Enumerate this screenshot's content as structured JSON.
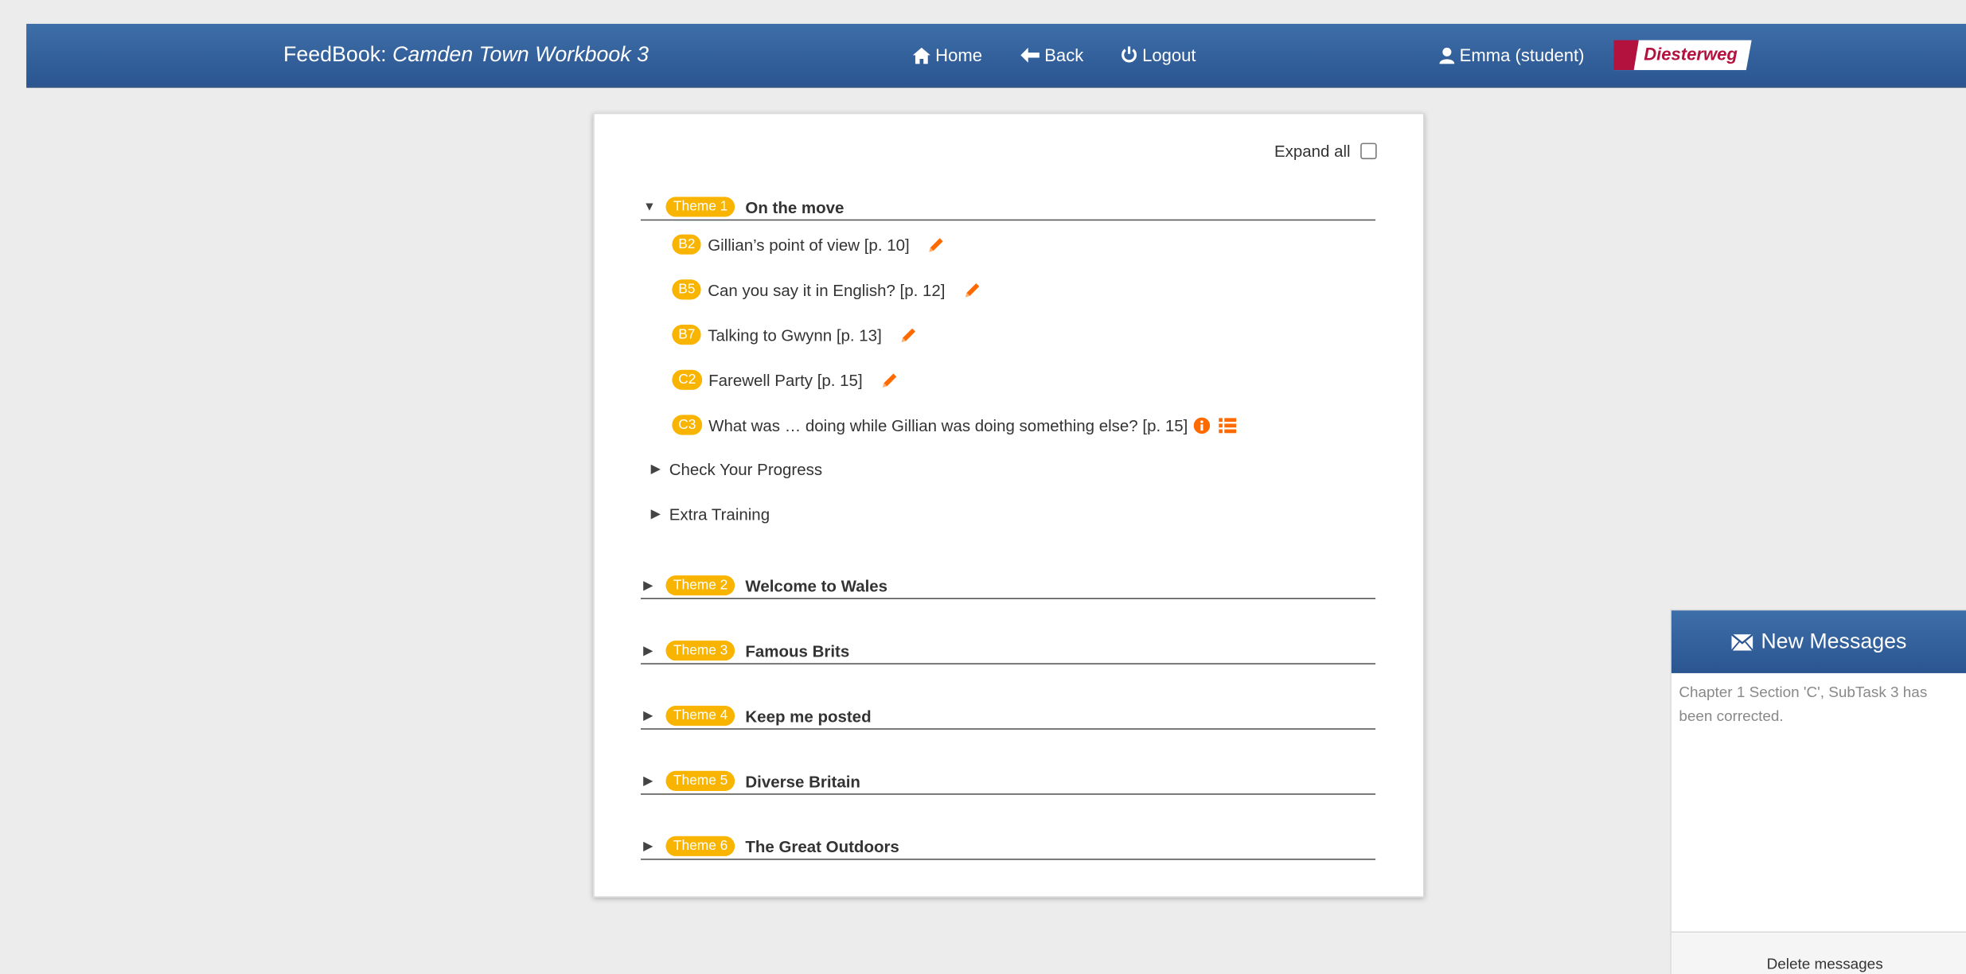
{
  "app": {
    "brand_prefix": "FeedBook: ",
    "book_title": "Camden Town Workbook 3"
  },
  "nav": {
    "home": "Home",
    "back": "Back",
    "logout": "Logout",
    "user": "Emma (student)",
    "logo": "Diesterweg"
  },
  "toc": {
    "expand_all": "Expand all",
    "themes": [
      {
        "badge": "Theme 1",
        "title": "On the move",
        "expanded": true
      },
      {
        "badge": "Theme 2",
        "title": "Welcome to Wales",
        "expanded": false
      },
      {
        "badge": "Theme 3",
        "title": "Famous Brits",
        "expanded": false
      },
      {
        "badge": "Theme 4",
        "title": "Keep me posted",
        "expanded": false
      },
      {
        "badge": "Theme 5",
        "title": "Diverse Britain",
        "expanded": false
      },
      {
        "badge": "Theme 6",
        "title": "The Great Outdoors",
        "expanded": false
      }
    ],
    "tasks": [
      {
        "badge": "B2",
        "title": "Gillian’s point of view [p. 10]",
        "icon": "pencil-icon"
      },
      {
        "badge": "B5",
        "title": "Can you say it in English? [p. 12]",
        "icon": "pencil-icon"
      },
      {
        "badge": "B7",
        "title": "Talking to Gwynn [p. 13]",
        "icon": "pencil-icon"
      },
      {
        "badge": "C2",
        "title": "Farewell Party [p. 15]",
        "icon": "pencil-icon"
      },
      {
        "badge": "C3",
        "title": "What was … doing while Gillian was doing something else? [p. 15]",
        "icon": "info-icon"
      }
    ],
    "sections": [
      "Check Your Progress",
      "Extra Training"
    ]
  },
  "messages": {
    "title": "New Messages",
    "items": [
      "Chapter 1 Section 'C', SubTask 3 has been corrected."
    ],
    "delete_label": "Delete messages"
  },
  "colors": {
    "navbar": "#2a5590",
    "badge": "#f9b400",
    "accent_icon": "#ff6a00",
    "logo_red": "#b3123f"
  }
}
